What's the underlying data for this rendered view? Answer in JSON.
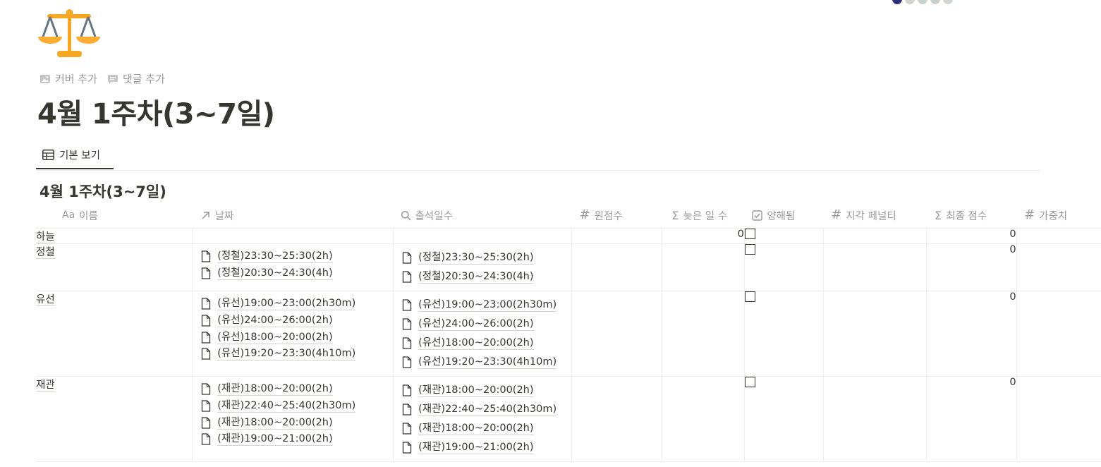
{
  "page": {
    "icon": "balance-scale-icon",
    "add_cover": "커버 추가",
    "add_comment": "댓글 추가",
    "title": "4월 1주차(3~7일)"
  },
  "presence_colors": [
    "#2f2f7a",
    "#cfd6cf",
    "#c9d3c9",
    "#c8d1c8",
    "#cfd6cf"
  ],
  "view_tab": {
    "label": "기본 보기",
    "icon": "table-icon"
  },
  "database": {
    "title": "4월 1주차(3~7일)",
    "columns": [
      {
        "label": "이름",
        "icon": "Aa"
      },
      {
        "label": "날짜",
        "icon": "relation-arrow-icon"
      },
      {
        "label": "출석일수",
        "icon": "search-icon"
      },
      {
        "label": "원점수",
        "icon": "#"
      },
      {
        "label": "늦은 일 수",
        "icon": "Σ"
      },
      {
        "label": "양해됨",
        "icon": "checkbox-icon"
      },
      {
        "label": "지각 페널티",
        "icon": "#"
      },
      {
        "label": "최종 점수",
        "icon": "Σ"
      },
      {
        "label": "가중치",
        "icon": "#"
      }
    ],
    "rows": [
      {
        "name": "하늘",
        "dates": [],
        "attendance": [],
        "late_days": "0",
        "excused": false,
        "final_score": "0"
      },
      {
        "name": "정철",
        "dates": [
          "(정철)23:30~25:30(2h)",
          "(정철)20:30~24:30(4h)"
        ],
        "attendance": [
          "(정철)23:30~25:30(2h)",
          "(정철)20:30~24:30(4h)"
        ],
        "late_days": "",
        "excused": false,
        "final_score": "0"
      },
      {
        "name": "유선",
        "dates": [
          "(유선)19:00~23:00(2h30m)",
          "(유선)24:00~26:00(2h)",
          "(유선)18:00~20:00(2h)",
          "(유선)19:20~23:30(4h10m)"
        ],
        "attendance": [
          "(유선)19:00~23:00(2h30m)",
          "(유선)24:00~26:00(2h)",
          "(유선)18:00~20:00(2h)",
          "(유선)19:20~23:30(4h10m)"
        ],
        "late_days": "",
        "excused": false,
        "final_score": "0"
      },
      {
        "name": "재관",
        "dates": [
          "(재관)18:00~20:00(2h)",
          "(재관)22:40~25:40(2h30m)",
          "(재관)18:00~20:00(2h)",
          "(재관)19:00~21:00(2h)"
        ],
        "attendance": [
          "(재관)18:00~20:00(2h)",
          "(재관)22:40~25:40(2h30m)",
          "(재관)18:00~20:00(2h)",
          "(재관)19:00~21:00(2h)"
        ],
        "late_days": "",
        "excused": false,
        "final_score": "0"
      }
    ]
  }
}
